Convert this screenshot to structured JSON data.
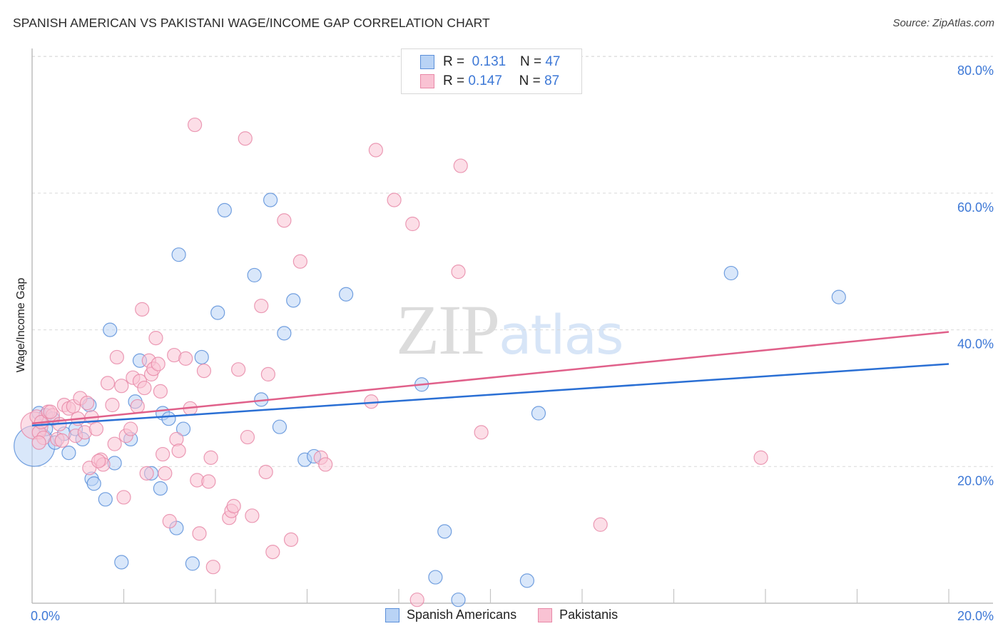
{
  "header": {
    "title": "SPANISH AMERICAN VS PAKISTANI WAGE/INCOME GAP CORRELATION CHART",
    "source": "Source: ZipAtlas.com"
  },
  "watermark": {
    "zip": "ZIP",
    "atlas": "atlas"
  },
  "legend": {
    "rows": [
      {
        "r_label": "R =",
        "r_value": "0.131",
        "n_label": "N =",
        "n_value": "47",
        "series": "Spanish Americans"
      },
      {
        "r_label": "R =",
        "r_value": "0.147",
        "n_label": "N =",
        "n_value": "87",
        "series": "Pakistanis"
      }
    ]
  },
  "bottom_legend": [
    "Spanish Americans",
    "Pakistanis"
  ],
  "colors": {
    "blue_fill": "#b9d3f5",
    "blue_stroke": "#5b8fd9",
    "blue_line": "#2a6fd4",
    "pink_fill": "#f9c2d3",
    "pink_stroke": "#e889a8",
    "pink_line": "#e0608a",
    "tick_label": "#3d78d6",
    "grid": "#d9d9d9"
  },
  "chart_data": {
    "type": "scatter",
    "title": "SPANISH AMERICAN VS PAKISTANI WAGE/INCOME GAP CORRELATION CHART",
    "xlabel": "",
    "ylabel": "Wage/Income Gap",
    "xlim": [
      0,
      20
    ],
    "ylim": [
      0,
      82
    ],
    "x_tick_labels": [
      {
        "value": 0,
        "label": "0.0%"
      },
      {
        "value": 20,
        "label": "20.0%"
      }
    ],
    "x_minor_ticks": [
      2,
      4,
      6,
      8,
      10,
      12,
      14,
      16,
      18,
      20
    ],
    "y_tick_labels": [
      {
        "value": 20,
        "label": "20.0%"
      },
      {
        "value": 40,
        "label": "40.0%"
      },
      {
        "value": 60,
        "label": "60.0%"
      },
      {
        "value": 80,
        "label": "80.0%"
      }
    ],
    "grid": true,
    "legend_position": "top-center",
    "series": [
      {
        "name": "Spanish Americans",
        "color": "blue",
        "R": 0.131,
        "N": 47,
        "trend": {
          "x": [
            0,
            20
          ],
          "y": [
            26.0,
            35.0
          ]
        },
        "points": [
          [
            0.05,
            23.0,
            3
          ],
          [
            0.15,
            27.8,
            1
          ],
          [
            0.3,
            27.5,
            1
          ],
          [
            0.45,
            27.0,
            1
          ],
          [
            0.3,
            25.5,
            1
          ],
          [
            0.5,
            23.5,
            1
          ],
          [
            0.7,
            24.8,
            1
          ],
          [
            0.8,
            22.0,
            1
          ],
          [
            0.95,
            25.5,
            1
          ],
          [
            1.1,
            24.0,
            1
          ],
          [
            1.25,
            29.0,
            1
          ],
          [
            1.3,
            18.2,
            1
          ],
          [
            1.35,
            17.5,
            1
          ],
          [
            1.6,
            15.2,
            1
          ],
          [
            1.7,
            40.0,
            1
          ],
          [
            1.8,
            20.5,
            1
          ],
          [
            1.95,
            6.0,
            1
          ],
          [
            2.15,
            24.0,
            1
          ],
          [
            2.25,
            29.5,
            1
          ],
          [
            2.35,
            35.5,
            1
          ],
          [
            2.6,
            19.0,
            1
          ],
          [
            2.8,
            16.8,
            1
          ],
          [
            2.85,
            27.8,
            1
          ],
          [
            2.98,
            27.0,
            1
          ],
          [
            3.15,
            11.0,
            1
          ],
          [
            3.2,
            51.0,
            1
          ],
          [
            3.3,
            25.5,
            1
          ],
          [
            3.5,
            5.8,
            1
          ],
          [
            3.7,
            36.0,
            1
          ],
          [
            4.05,
            42.5,
            1
          ],
          [
            4.2,
            57.5,
            1
          ],
          [
            4.85,
            48.0,
            1
          ],
          [
            5.0,
            29.8,
            1
          ],
          [
            5.2,
            59.0,
            1
          ],
          [
            5.4,
            25.8,
            1
          ],
          [
            5.5,
            39.5,
            1
          ],
          [
            5.7,
            44.3,
            1
          ],
          [
            5.95,
            21.0,
            1
          ],
          [
            6.15,
            21.5,
            1
          ],
          [
            6.85,
            45.2,
            1
          ],
          [
            8.5,
            32.0,
            1
          ],
          [
            9.0,
            10.5,
            1
          ],
          [
            8.8,
            3.8,
            1
          ],
          [
            9.3,
            0.5,
            1
          ],
          [
            10.8,
            3.3,
            1
          ],
          [
            11.05,
            27.8,
            1
          ],
          [
            15.25,
            48.3,
            1
          ],
          [
            17.6,
            44.8,
            1
          ]
        ]
      },
      {
        "name": "Pakistanis",
        "color": "pink",
        "R": 0.147,
        "N": 87,
        "trend": {
          "x": [
            0,
            20
          ],
          "y": [
            26.3,
            39.7
          ]
        },
        "points": [
          [
            0.05,
            26.0,
            2
          ],
          [
            0.1,
            27.3,
            1
          ],
          [
            0.15,
            25.0,
            1
          ],
          [
            0.2,
            26.5,
            1
          ],
          [
            0.25,
            24.2,
            1
          ],
          [
            0.35,
            28.0,
            1
          ],
          [
            0.45,
            27.5,
            1
          ],
          [
            0.55,
            24.0,
            1
          ],
          [
            0.6,
            26.2,
            1
          ],
          [
            0.7,
            29.0,
            1
          ],
          [
            0.8,
            28.5,
            1
          ],
          [
            0.9,
            28.8,
            1
          ],
          [
            0.95,
            24.5,
            1
          ],
          [
            1.05,
            30.0,
            1
          ],
          [
            1.15,
            25.0,
            1
          ],
          [
            1.2,
            29.3,
            1
          ],
          [
            1.3,
            27.2,
            1
          ],
          [
            1.4,
            25.5,
            1
          ],
          [
            1.5,
            21.0,
            1
          ],
          [
            1.55,
            20.3,
            1
          ],
          [
            1.65,
            32.2,
            1
          ],
          [
            1.75,
            29.0,
            1
          ],
          [
            1.8,
            23.3,
            1
          ],
          [
            1.85,
            36.0,
            1
          ],
          [
            1.95,
            31.8,
            1
          ],
          [
            2.0,
            15.5,
            1
          ],
          [
            2.05,
            24.5,
            1
          ],
          [
            2.15,
            25.5,
            1
          ],
          [
            2.2,
            33.0,
            1
          ],
          [
            2.3,
            28.8,
            1
          ],
          [
            2.35,
            32.5,
            1
          ],
          [
            2.4,
            43.0,
            1
          ],
          [
            2.5,
            19.0,
            1
          ],
          [
            2.55,
            35.5,
            1
          ],
          [
            2.6,
            33.5,
            1
          ],
          [
            2.65,
            34.3,
            1
          ],
          [
            2.7,
            38.8,
            1
          ],
          [
            2.75,
            35.0,
            1
          ],
          [
            2.8,
            31.0,
            1
          ],
          [
            2.85,
            21.8,
            1
          ],
          [
            2.9,
            19.0,
            1
          ],
          [
            3.0,
            12.0,
            1
          ],
          [
            3.1,
            36.3,
            1
          ],
          [
            3.15,
            24.0,
            1
          ],
          [
            3.2,
            22.3,
            1
          ],
          [
            3.35,
            35.8,
            1
          ],
          [
            3.45,
            28.5,
            1
          ],
          [
            3.6,
            18.0,
            1
          ],
          [
            3.65,
            10.2,
            1
          ],
          [
            3.75,
            34.0,
            1
          ],
          [
            3.85,
            17.8,
            1
          ],
          [
            3.9,
            21.3,
            1
          ],
          [
            3.95,
            5.3,
            1
          ],
          [
            4.3,
            12.5,
            1
          ],
          [
            4.35,
            13.5,
            1
          ],
          [
            4.4,
            14.2,
            1
          ],
          [
            4.5,
            34.2,
            1
          ],
          [
            4.65,
            68.0,
            1
          ],
          [
            4.7,
            24.3,
            1
          ],
          [
            4.8,
            12.8,
            1
          ],
          [
            5.0,
            43.5,
            1
          ],
          [
            5.1,
            19.2,
            1
          ],
          [
            5.15,
            33.5,
            1
          ],
          [
            5.25,
            7.5,
            1
          ],
          [
            5.5,
            56.0,
            1
          ],
          [
            5.65,
            9.3,
            1
          ],
          [
            5.85,
            50.0,
            1
          ],
          [
            6.3,
            21.3,
            1
          ],
          [
            6.4,
            20.3,
            1
          ],
          [
            3.55,
            70.0,
            1
          ],
          [
            7.5,
            66.3,
            1
          ],
          [
            7.4,
            29.5,
            1
          ],
          [
            7.9,
            59.0,
            1
          ],
          [
            8.3,
            55.5,
            1
          ],
          [
            8.4,
            0.5,
            1
          ],
          [
            9.3,
            48.5,
            1
          ],
          [
            9.35,
            64.0,
            1
          ],
          [
            9.8,
            25.0,
            1
          ],
          [
            12.4,
            11.5,
            1
          ],
          [
            15.9,
            21.3,
            1
          ],
          [
            0.4,
            28.0,
            1
          ],
          [
            1.0,
            27.0,
            1
          ],
          [
            0.65,
            23.8,
            1
          ],
          [
            1.25,
            19.8,
            1
          ],
          [
            2.45,
            31.5,
            1
          ],
          [
            1.45,
            20.8,
            1
          ],
          [
            0.15,
            23.5,
            1
          ]
        ]
      }
    ]
  }
}
